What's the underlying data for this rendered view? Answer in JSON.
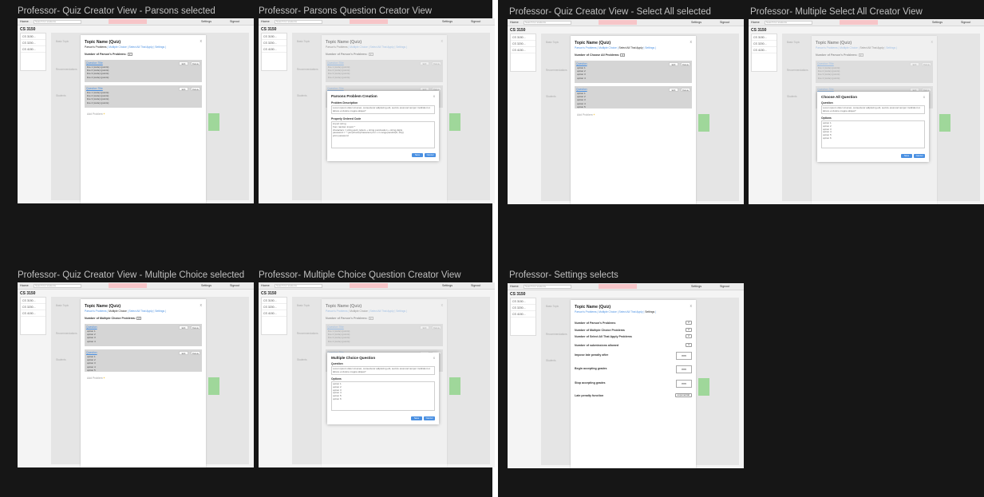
{
  "frames": [
    {
      "title": "Professor- Quiz Creator View - Parsons selected"
    },
    {
      "title": "Professor- Parsons Question Creator View"
    },
    {
      "title": "Professor- Quiz Creator View - Select All selected"
    },
    {
      "title": "Professor- Multiple Select All Creator View"
    },
    {
      "title": "Professor- Quiz Creator View - Multiple Choice selected"
    },
    {
      "title": "Professor- Multiple Choice Question Creator View"
    },
    {
      "title": "Professor- Settings selects"
    }
  ],
  "app": {
    "home": "Home",
    "search_placeholder": "Search for students",
    "settings": "Settings",
    "signout": "Signout",
    "course": "CS 3150",
    "left_rows": [
      "CS    3150...",
      "CS    3200...",
      "CS    4150..."
    ],
    "bg_tabs": [
      "Basic Topic",
      "Recommendations",
      "Students"
    ]
  },
  "modal": {
    "title": "Topic Name (Quiz)",
    "close": "x",
    "links": [
      "Parson's Problems",
      "Multiple Choice",
      "Select All That Apply",
      "Settings"
    ],
    "parsons_count_label": "Number of Parson's Problems:",
    "choose_all_count_label": "Number of Choose All Problems:",
    "mc_count_label": "Number of Multiple Choice Problems:",
    "count_value": "2",
    "question_title": "Question Title",
    "question": "Question",
    "line_items": [
      "line 1 (code) (points)",
      "line 2 (code) (points)",
      "line 3 (code) (points)",
      "line 4 (code) (points)"
    ],
    "option_items": [
      "option 1",
      "option 2",
      "option 3",
      "option 4"
    ],
    "option_items_long": [
      "option 1",
      "option 2",
      "option 3",
      "option 4",
      "option 5"
    ],
    "edit": "Edit",
    "delete": "Delete",
    "add_problem": "Add Problem"
  },
  "parsons_popup": {
    "title": "Parsons Problem Creation",
    "desc_label": "Problem Description",
    "desc_text": "Lorem ipsum dolor sit amet, consectetur adipiscing elit, sed do eiusmod tempor incididunt ut labore et dolore magna aliqua?",
    "code_label": "Properly Ordered Code",
    "code_lines": [
      "import string",
      "from random import *",
      "characters = string.ascii_letters + string.punctuation + string.digits",
      "password = \"\".join(choice(characters) for x in range(randint(8, 16)))",
      "print password"
    ],
    "save": "Save",
    "cancel": "Cancel"
  },
  "choose_all_popup": {
    "title": "Choose All Question",
    "q_label": "Question",
    "q_text": "Lorem ipsum dolor sit amet, consectetur adipiscing elit, sed do eiusmod tempor incididunt ut labore et dolore magna aliqua?",
    "opt_label": "Options",
    "options": [
      "option 1",
      "option 2",
      "option 3",
      "option 4",
      "option 5",
      "option 6"
    ],
    "save": "Save",
    "cancel": "Cancel"
  },
  "mc_popup": {
    "title": "Multiple Choice Question",
    "q_label": "Question",
    "q_text": "Lorem ipsum dolor sit amet, consectetur adipiscing elit, sed do eiusmod tempor incididunt ut labore et dolore magna aliqua?",
    "opt_label": "Options",
    "options": [
      "option 1",
      "option 2",
      "option 3",
      "option 4",
      "option 5",
      "option 6"
    ],
    "save": "Save",
    "cancel": "Cancel"
  },
  "settings": {
    "rows": [
      {
        "label": "Number of Parson's Problems",
        "value": "2"
      },
      {
        "label": "Number of Multiple Choice Problems",
        "value": "2"
      },
      {
        "label": "Number of Select All That Apply Problems",
        "value": "2"
      },
      {
        "label": "Number of submissions allowed",
        "value": "3"
      },
      {
        "label": "Impose late penalty after",
        "value": "mm"
      },
      {
        "label": "Begin accepting grades",
        "value": "mm"
      },
      {
        "label": "Stop accepting grades",
        "value": "mm"
      },
      {
        "label": "Late penalty function",
        "value": "exponential"
      }
    ]
  },
  "colors": {
    "board": "#161616",
    "link": "#4a90e2",
    "alert": "#f7c5c8",
    "green": "#9fd79a",
    "plus": "#f1c232"
  }
}
